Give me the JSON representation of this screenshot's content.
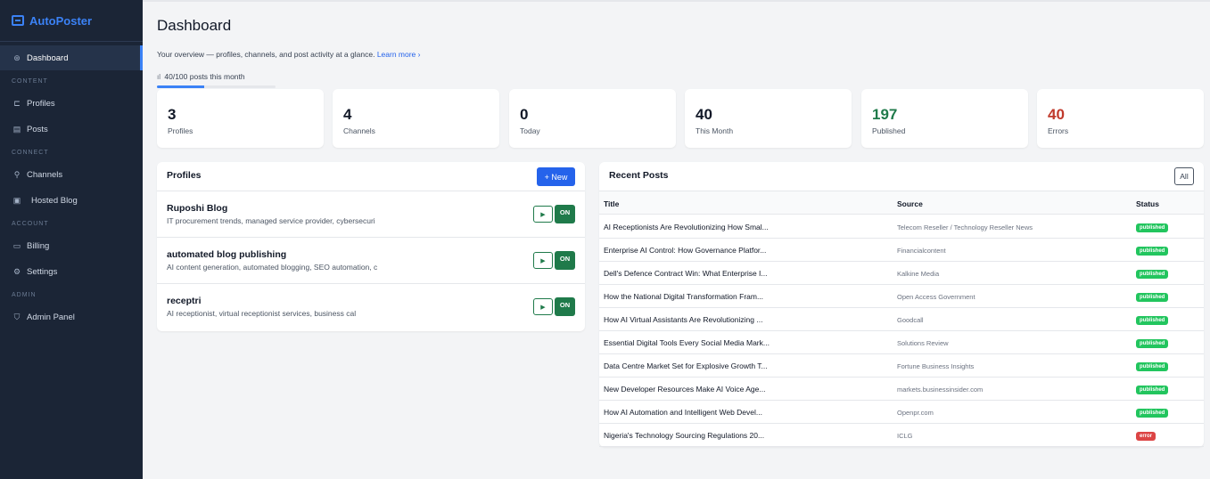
{
  "brand": {
    "name": "AutoPoster"
  },
  "sidebar": {
    "items": [
      {
        "label": "Dashboard",
        "icon": "gauge-icon",
        "glyph": "⊛"
      },
      {
        "label": "Profiles",
        "icon": "briefcase-icon",
        "glyph": "⊏"
      },
      {
        "label": "Posts",
        "icon": "document-icon",
        "glyph": "▤"
      },
      {
        "label": "Channels",
        "icon": "antenna-icon",
        "glyph": "⚲"
      },
      {
        "label": "Hosted Blog",
        "icon": "blog-icon",
        "glyph": "▣"
      },
      {
        "label": "Billing",
        "icon": "credit-card-icon",
        "glyph": "▭"
      },
      {
        "label": "Settings",
        "icon": "gear-icon",
        "glyph": "⚙"
      },
      {
        "label": "Admin Panel",
        "icon": "shield-icon",
        "glyph": "⛉"
      }
    ],
    "sections": [
      "CONTENT",
      "CONNECT",
      "ACCOUNT",
      "ADMIN"
    ]
  },
  "header": {
    "title": "Dashboard",
    "subtitle": "Your overview — profiles, channels, and post activity at a glance.",
    "learn_more": "Learn more ›",
    "usage_text": "40/100 posts this month",
    "usage_fraction": 0.4
  },
  "stats": [
    {
      "value": "3",
      "label": "Profiles"
    },
    {
      "value": "4",
      "label": "Channels"
    },
    {
      "value": "0",
      "label": "Today"
    },
    {
      "value": "40",
      "label": "This Month"
    },
    {
      "value": "197",
      "label": "Published"
    },
    {
      "value": "40",
      "label": "Errors"
    }
  ],
  "profiles": {
    "title": "Profiles",
    "new_label": "+ New",
    "items": [
      {
        "name": "Ruposhi Blog",
        "desc": "IT procurement trends, managed service provider, cybersecuri",
        "toggle": "ON"
      },
      {
        "name": "automated blog publishing",
        "desc": "AI content generation, automated blogging, SEO automation, c",
        "toggle": "ON"
      },
      {
        "name": "receptri",
        "desc": "AI receptionist, virtual receptionist services, business cal",
        "toggle": "ON"
      }
    ]
  },
  "recent_posts": {
    "title": "Recent Posts",
    "all_label": "All",
    "columns": {
      "title": "Title",
      "source": "Source",
      "status": "Status"
    },
    "rows": [
      {
        "title": "AI Receptionists Are Revolutionizing How Smal...",
        "source": "Telecom Reseller / Technology Reseller News",
        "status": "published"
      },
      {
        "title": "Enterprise AI Control: How Governance Platfor...",
        "source": "Financialcontent",
        "status": "published"
      },
      {
        "title": "Dell's Defence Contract Win: What Enterprise I...",
        "source": "Kalkine Media",
        "status": "published"
      },
      {
        "title": "How the National Digital Transformation Fram...",
        "source": "Open Access Government",
        "status": "published"
      },
      {
        "title": "How AI Virtual Assistants Are Revolutionizing ...",
        "source": "Goodcall",
        "status": "published"
      },
      {
        "title": "Essential Digital Tools Every Social Media Mark...",
        "source": "Solutions Review",
        "status": "published"
      },
      {
        "title": "Data Centre Market Set for Explosive Growth T...",
        "source": "Fortune Business Insights",
        "status": "published"
      },
      {
        "title": "New Developer Resources Make AI Voice Age...",
        "source": "markets.businessinsider.com",
        "status": "published"
      },
      {
        "title": "How AI Automation and Intelligent Web Devel...",
        "source": "Openpr.com",
        "status": "published"
      },
      {
        "title": "Nigeria's Technology Sourcing Regulations 20...",
        "source": "ICLG",
        "status": "error"
      }
    ]
  },
  "colors": {
    "accent": "#2563eb",
    "sidebar_bg": "#1b2536",
    "success": "#1f7a4a",
    "published": "#22c55e",
    "error": "#dc4545"
  }
}
